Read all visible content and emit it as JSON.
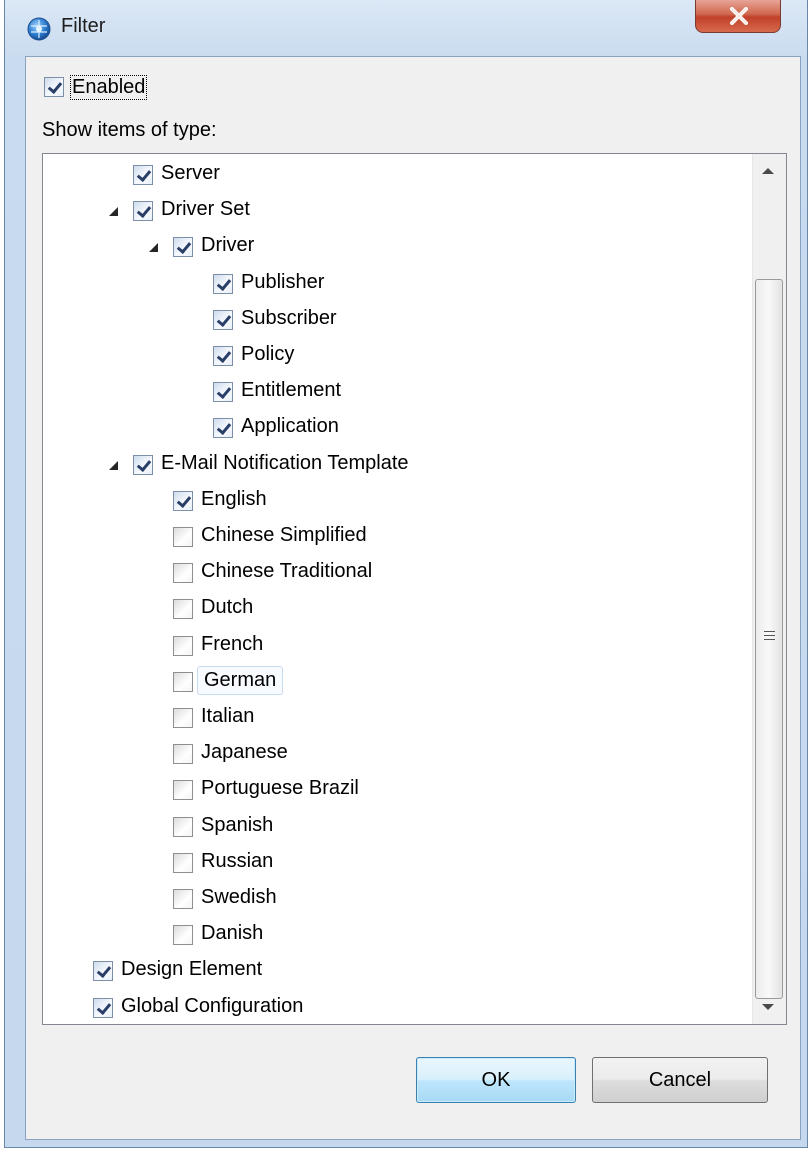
{
  "window": {
    "title": "Filter",
    "app_icon": "globe-icon",
    "close_icon": "close-icon"
  },
  "enabled": {
    "label": "Enabled",
    "checked": true
  },
  "show_items_label": "Show items of type:",
  "tree": [
    {
      "label": "Server",
      "checked": true,
      "level": 1,
      "expandable": false
    },
    {
      "label": "Driver Set",
      "checked": true,
      "level": 1,
      "expandable": true
    },
    {
      "label": "Driver",
      "checked": true,
      "level": 2,
      "expandable": true
    },
    {
      "label": "Publisher",
      "checked": true,
      "level": 3,
      "expandable": false
    },
    {
      "label": "Subscriber",
      "checked": true,
      "level": 3,
      "expandable": false
    },
    {
      "label": "Policy",
      "checked": true,
      "level": 3,
      "expandable": false
    },
    {
      "label": "Entitlement",
      "checked": true,
      "level": 3,
      "expandable": false
    },
    {
      "label": "Application",
      "checked": true,
      "level": 3,
      "expandable": false
    },
    {
      "label": "E-Mail Notification Template",
      "checked": true,
      "level": 1,
      "expandable": true
    },
    {
      "label": "English",
      "checked": true,
      "level": 2,
      "expandable": false
    },
    {
      "label": "Chinese Simplified",
      "checked": false,
      "level": 2,
      "expandable": false
    },
    {
      "label": "Chinese Traditional",
      "checked": false,
      "level": 2,
      "expandable": false
    },
    {
      "label": "Dutch",
      "checked": false,
      "level": 2,
      "expandable": false
    },
    {
      "label": "French",
      "checked": false,
      "level": 2,
      "expandable": false
    },
    {
      "label": "German",
      "checked": false,
      "level": 2,
      "expandable": false,
      "hover": true
    },
    {
      "label": "Italian",
      "checked": false,
      "level": 2,
      "expandable": false
    },
    {
      "label": "Japanese",
      "checked": false,
      "level": 2,
      "expandable": false
    },
    {
      "label": "Portuguese Brazil",
      "checked": false,
      "level": 2,
      "expandable": false
    },
    {
      "label": "Spanish",
      "checked": false,
      "level": 2,
      "expandable": false
    },
    {
      "label": "Russian",
      "checked": false,
      "level": 2,
      "expandable": false
    },
    {
      "label": "Swedish",
      "checked": false,
      "level": 2,
      "expandable": false
    },
    {
      "label": "Danish",
      "checked": false,
      "level": 2,
      "expandable": false
    },
    {
      "label": "Design Element",
      "checked": true,
      "level": 0,
      "expandable": false
    },
    {
      "label": "Global Configuration",
      "checked": true,
      "level": 0,
      "expandable": false
    }
  ],
  "buttons": {
    "ok": "OK",
    "cancel": "Cancel"
  }
}
